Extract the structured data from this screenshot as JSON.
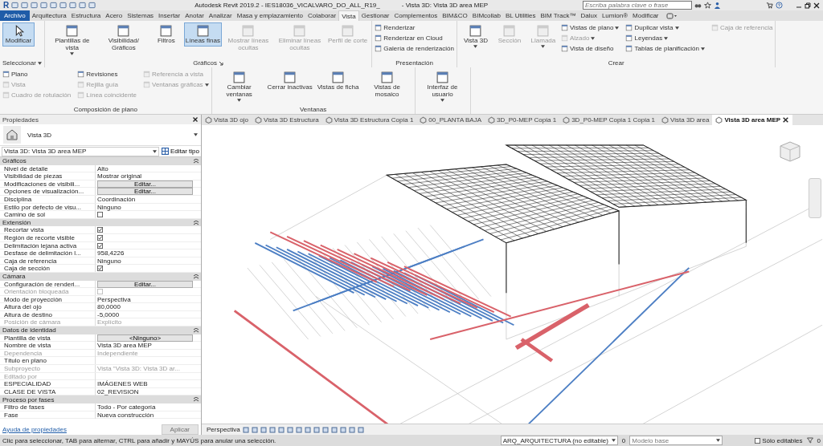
{
  "window": {
    "app_logo": "R",
    "title": "Autodesk Revit 2019.2 - IES18036_VICALVARO_DO_ALL_R19_",
    "view_title": "- Vista 3D: Vista 3D area MEP",
    "search": {
      "placeholder": "Escriba palabra clave o frase"
    }
  },
  "ribbon_tabs": [
    {
      "label": "Archivo",
      "kind": "application",
      "selected": false
    },
    {
      "label": "Arquitectura",
      "kind": "tab",
      "selected": false
    },
    {
      "label": "Estructura",
      "kind": "tab",
      "selected": false
    },
    {
      "label": "Acero",
      "kind": "tab",
      "selected": false
    },
    {
      "label": "Sistemas",
      "kind": "tab",
      "selected": false
    },
    {
      "label": "Insertar",
      "kind": "tab",
      "selected": false
    },
    {
      "label": "Anotar",
      "kind": "tab",
      "selected": false
    },
    {
      "label": "Analizar",
      "kind": "tab",
      "selected": false
    },
    {
      "label": "Masa y emplazamiento",
      "kind": "tab",
      "selected": false
    },
    {
      "label": "Colaborar",
      "kind": "tab",
      "selected": false
    },
    {
      "label": "Vista",
      "kind": "tab",
      "selected": true
    },
    {
      "label": "Gestionar",
      "kind": "tab",
      "selected": false
    },
    {
      "label": "Complementos",
      "kind": "tab",
      "selected": false
    },
    {
      "label": "BIM&CO",
      "kind": "tab",
      "selected": false
    },
    {
      "label": "BIMcollab",
      "kind": "tab",
      "selected": false
    },
    {
      "label": "BL Utilities",
      "kind": "tab",
      "selected": false
    },
    {
      "label": "BIM Track™",
      "kind": "tab",
      "selected": false
    },
    {
      "label": "Dalux",
      "kind": "tab",
      "selected": false
    },
    {
      "label": "Lumion®",
      "kind": "tab",
      "selected": false
    },
    {
      "label": "Modificar",
      "kind": "tab",
      "selected": false
    }
  ],
  "ribbon_panels": [
    {
      "label": "Seleccionar",
      "dropdown": true,
      "launcher": false,
      "tools": [
        {
          "label": "Modificar",
          "kind": "large",
          "selected": true,
          "disabled": false,
          "dropdown": false
        }
      ]
    },
    {
      "label": "Gráficos",
      "dropdown": false,
      "launcher": true,
      "tools": [
        {
          "label": "Plantillas de vista",
          "kind": "large",
          "selected": false,
          "disabled": false,
          "dropdown": true
        },
        {
          "label": "Visibilidad/ Gráficos",
          "kind": "large",
          "selected": false,
          "disabled": false,
          "dropdown": false
        },
        {
          "label": "Filtros",
          "kind": "large",
          "selected": false,
          "disabled": false,
          "dropdown": false
        },
        {
          "label": "Líneas finas",
          "kind": "large",
          "selected": true,
          "disabled": false,
          "dropdown": false
        },
        {
          "label": "Mostrar líneas ocultas",
          "kind": "large",
          "selected": false,
          "disabled": true,
          "dropdown": false
        },
        {
          "label": "Eliminar líneas ocultas",
          "kind": "large",
          "selected": false,
          "disabled": true,
          "dropdown": false
        },
        {
          "label": "Perfil de corte",
          "kind": "large",
          "selected": false,
          "disabled": true,
          "dropdown": false
        }
      ]
    },
    {
      "label": "Presentación",
      "dropdown": false,
      "launcher": false,
      "tools": [
        {
          "label": "Renderizar",
          "kind": "small",
          "selected": false,
          "disabled": false,
          "dropdown": false
        },
        {
          "label": "Renderizar  en Cloud",
          "kind": "small",
          "selected": false,
          "disabled": false,
          "dropdown": false
        },
        {
          "label": "Galería de renderización",
          "kind": "small",
          "selected": false,
          "disabled": false,
          "dropdown": false
        }
      ]
    },
    {
      "label": "Crear",
      "dropdown": false,
      "launcher": false,
      "tools": [
        {
          "label": "Vista 3D",
          "kind": "large",
          "selected": false,
          "disabled": false,
          "dropdown": true
        },
        {
          "label": "Sección",
          "kind": "large",
          "selected": false,
          "disabled": true,
          "dropdown": false
        },
        {
          "label": "Llamada",
          "kind": "large",
          "selected": false,
          "disabled": true,
          "dropdown": true
        },
        {
          "label": "Vistas de plano",
          "kind": "small",
          "selected": false,
          "disabled": false,
          "dropdown": true
        },
        {
          "label": "Alzado",
          "kind": "small",
          "selected": false,
          "disabled": true,
          "dropdown": true
        },
        {
          "label": "Vista de diseño",
          "kind": "small",
          "selected": false,
          "disabled": false,
          "dropdown": false
        },
        {
          "label": "Duplicar vista",
          "kind": "small",
          "selected": false,
          "disabled": false,
          "dropdown": true
        },
        {
          "label": "Leyendas",
          "kind": "small",
          "selected": false,
          "disabled": false,
          "dropdown": true
        },
        {
          "label": "Tablas de planificación",
          "kind": "small",
          "selected": false,
          "disabled": false,
          "dropdown": true
        },
        {
          "label": "Caja de referencia",
          "kind": "small",
          "selected": false,
          "disabled": true,
          "dropdown": false
        }
      ]
    },
    {
      "label": "Composición de plano",
      "dropdown": false,
      "launcher": false,
      "tools": [
        {
          "label": "Plano",
          "kind": "small",
          "selected": false,
          "disabled": false,
          "dropdown": false
        },
        {
          "label": "Vista",
          "kind": "small",
          "selected": false,
          "disabled": true,
          "dropdown": false
        },
        {
          "label": "Cuadro de rotulación",
          "kind": "small",
          "selected": false,
          "disabled": true,
          "dropdown": false
        },
        {
          "label": "Revisiones",
          "kind": "small",
          "selected": false,
          "disabled": false,
          "dropdown": false
        },
        {
          "label": "Rejilla guía",
          "kind": "small",
          "selected": false,
          "disabled": true,
          "dropdown": false
        },
        {
          "label": "Línea coincidente",
          "kind": "small",
          "selected": false,
          "disabled": true,
          "dropdown": false
        },
        {
          "label": "Referencia a vista",
          "kind": "small",
          "selected": false,
          "disabled": true,
          "dropdown": false
        },
        {
          "label": "Ventanas gráficas",
          "kind": "small",
          "selected": false,
          "disabled": true,
          "dropdown": true
        }
      ]
    },
    {
      "label": "Ventanas",
      "dropdown": false,
      "launcher": false,
      "tools": [
        {
          "label": "Cambiar ventanas",
          "kind": "large",
          "selected": false,
          "disabled": false,
          "dropdown": true
        },
        {
          "label": "Cerrar inactivas",
          "kind": "large",
          "selected": false,
          "disabled": false,
          "dropdown": false
        },
        {
          "label": "Vistas de ficha",
          "kind": "large",
          "selected": false,
          "disabled": false,
          "dropdown": false
        },
        {
          "label": "Vistas de mosaico",
          "kind": "large",
          "selected": false,
          "disabled": false,
          "dropdown": false
        }
      ]
    },
    {
      "dropdown": false,
      "launcher": false,
      "tools": [
        {
          "label": "Interfaz de usuario",
          "kind": "large",
          "selected": false,
          "disabled": false,
          "dropdown": true
        }
      ]
    }
  ],
  "properties": {
    "title": "Propiedades",
    "type_name": "Vista 3D",
    "selector": "Vista 3D: Vista 3D area MEP",
    "edit_type": "Editar tipo",
    "groups": [
      {
        "name": "Gráficos",
        "rows": [
          {
            "label": "Nivel de detalle",
            "value": "Alto",
            "kind": "text",
            "disabled": false
          },
          {
            "label": "Visibilidad de piezas",
            "value": "Mostrar original",
            "kind": "text",
            "disabled": false
          },
          {
            "label": "Modificaciones de visibili...",
            "value": "Editar...",
            "kind": "button",
            "disabled": false
          },
          {
            "label": "Opciones de visualización...",
            "value": "Editar...",
            "kind": "button",
            "disabled": false
          },
          {
            "label": "Disciplina",
            "value": "Coordinación",
            "kind": "text",
            "disabled": false
          },
          {
            "label": "Estilo por defecto de visu...",
            "value": "Ninguno",
            "kind": "text",
            "disabled": false
          },
          {
            "label": "Camino de sol",
            "kind": "checkbox",
            "checked": false,
            "disabled": false
          }
        ]
      },
      {
        "name": "Extensión",
        "rows": [
          {
            "label": "Recortar vista",
            "kind": "checkbox",
            "checked": true,
            "disabled": false
          },
          {
            "label": "Región de recorte visible",
            "kind": "checkbox",
            "checked": true,
            "disabled": false
          },
          {
            "label": "Delimitación lejana activa",
            "kind": "checkbox",
            "checked": true,
            "disabled": false
          },
          {
            "label": "Desfase de delimitación l...",
            "value": "958,4226",
            "kind": "text",
            "disabled": false
          },
          {
            "label": "Caja de referencia",
            "value": "Ninguno",
            "kind": "text",
            "disabled": false
          },
          {
            "label": "Caja de sección",
            "kind": "checkbox",
            "checked": true,
            "disabled": false
          }
        ]
      },
      {
        "name": "Cámara",
        "rows": [
          {
            "label": "Configuración de renderi...",
            "value": "Editar...",
            "kind": "button",
            "disabled": false
          },
          {
            "label": "Orientación bloqueada",
            "kind": "checkbox",
            "checked": false,
            "disabled": true
          },
          {
            "label": "Modo de proyección",
            "value": "Perspectiva",
            "kind": "text",
            "disabled": false
          },
          {
            "label": "Altura del ojo",
            "value": "80,0000",
            "kind": "text",
            "disabled": false
          },
          {
            "label": "Altura de destino",
            "value": "-5,0000",
            "kind": "text",
            "disabled": false
          },
          {
            "label": "Posición de cámara",
            "value": "Explícito",
            "kind": "text",
            "disabled": true
          }
        ]
      },
      {
        "name": "Datos de identidad",
        "rows": [
          {
            "label": "Plantilla de vista",
            "value": "<Ninguno>",
            "kind": "button",
            "disabled": false
          },
          {
            "label": "Nombre de vista",
            "value": "Vista 3D area MEP",
            "kind": "text",
            "disabled": false
          },
          {
            "label": "Dependencia",
            "value": "Independiente",
            "kind": "text",
            "disabled": true
          },
          {
            "label": "Título en plano",
            "kind": "text",
            "disabled": false
          },
          {
            "label": "Subproyecto",
            "value": "Vista \"Vista 3D: Vista 3D ar...",
            "kind": "text",
            "disabled": true
          },
          {
            "label": "Editado por",
            "kind": "text",
            "disabled": true
          },
          {
            "label": "ESPECIALIDAD",
            "value": "IMÁGENES WEB",
            "kind": "text",
            "disabled": false
          },
          {
            "label": "CLASE DE VISTA",
            "value": "02_REVISION",
            "kind": "text",
            "disabled": false
          }
        ]
      },
      {
        "name": "Proceso por fases",
        "rows": [
          {
            "label": "Filtro de fases",
            "value": "Todo - Por categoría",
            "kind": "text",
            "disabled": false
          },
          {
            "label": "Fase",
            "value": "Nueva construcción",
            "kind": "text",
            "disabled": false
          }
        ]
      }
    ],
    "help_link": "Ayuda de propiedades",
    "apply": {
      "label": "Aplicar",
      "disabled": true
    }
  },
  "view_tabs": [
    {
      "label": "Vista 3D ojo",
      "selected": false
    },
    {
      "label": "Vista 3D Estructura",
      "selected": false
    },
    {
      "label": "Vista 3D Estructura Copia 1",
      "selected": false
    },
    {
      "label": "00_PLANTA BAJA",
      "selected": false
    },
    {
      "label": "3D_P0-MEP Copia 1",
      "selected": false
    },
    {
      "label": "3D_P0-MEP Copia 1 Copia 1",
      "selected": false
    },
    {
      "label": "Vista 3D area",
      "selected": false
    },
    {
      "label": "Vista 3D area MEP",
      "selected": true
    }
  ],
  "view_controls": {
    "projection": "Perspectiva"
  },
  "status_bar": {
    "message": "Clic para seleccionar, TAB para alternar, CTRL para añadir y MAYÚS para anular una selección.",
    "workset": "ARQ_ARQUITECTURA (no editable)",
    "workset_count": "0",
    "design_option": "Modelo base",
    "editable_only": {
      "label": "Sólo editables",
      "checked": false
    },
    "filter_count": "0"
  }
}
